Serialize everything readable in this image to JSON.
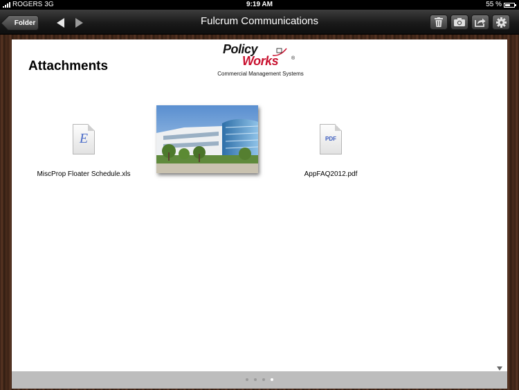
{
  "status_bar": {
    "carrier": "ROGERS",
    "network": "3G",
    "time": "9:19 AM",
    "battery_percent": "55 %",
    "battery_level": 0.55
  },
  "toolbar": {
    "folder_label": "Folder",
    "title": "Fulcrum Communications",
    "icons": [
      "trash-icon",
      "camera-icon",
      "share-icon",
      "gear-icon"
    ]
  },
  "logo": {
    "line1": "Policy",
    "line2": "Works",
    "registered": "®",
    "tagline": "Commercial Management Systems"
  },
  "main": {
    "heading": "Attachments",
    "attachments": [
      {
        "type": "excel",
        "icon_glyph": "E",
        "label": "MiscProp Floater Schedule.xls"
      },
      {
        "type": "image",
        "label": ""
      },
      {
        "type": "pdf",
        "icon_glyph": "PDF",
        "label": "AppFAQ2012.pdf"
      }
    ]
  },
  "pager": {
    "count": 4,
    "active_index": 3
  },
  "colors": {
    "toolbar_dark": "#1a1a1a",
    "brand_red": "#c8102e",
    "icon_blue": "#4a6bc8",
    "footer_gray": "#bdbdbd"
  }
}
